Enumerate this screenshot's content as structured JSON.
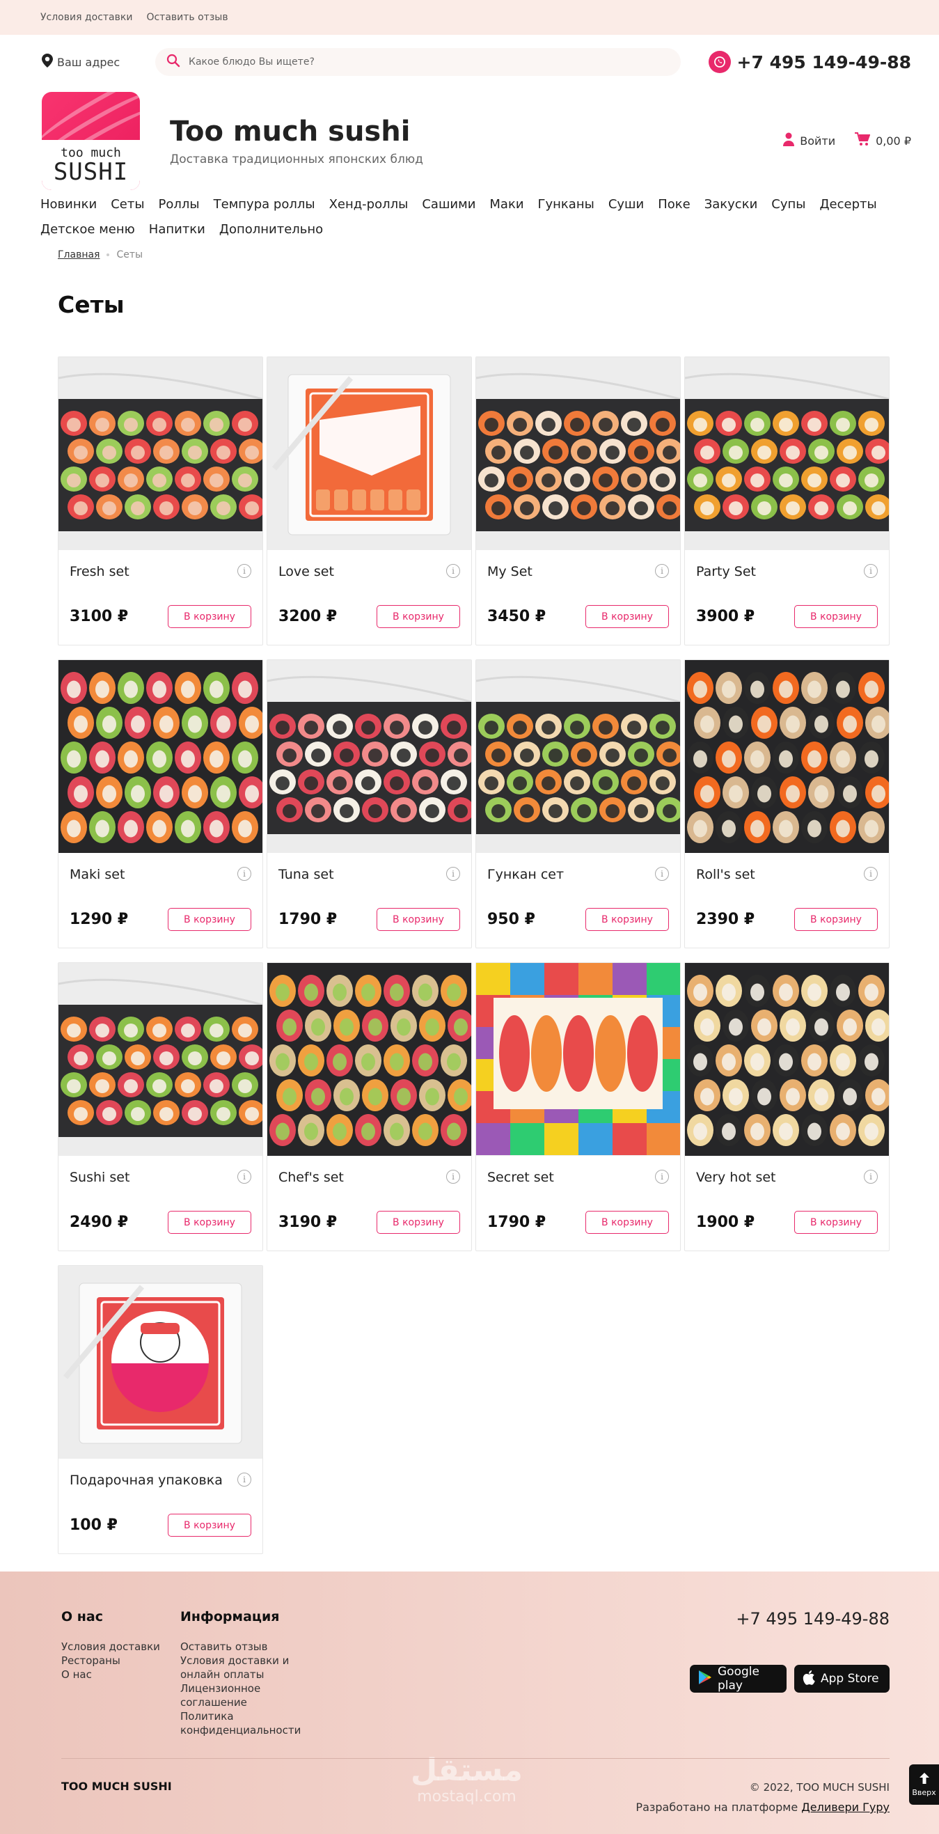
{
  "topbar": {
    "links": [
      "Условия доставки",
      "Оставить отзыв"
    ]
  },
  "header": {
    "address": "Ваш адрес",
    "search_placeholder": "Какое блюдо Вы ищете?",
    "phone": "+7 495 149-49-88",
    "logo_line1": "too much",
    "logo_line2": "SUSHI",
    "brand_title": "Too much sushi",
    "brand_subtitle": "Доставка традиционных японских блюд",
    "login": "Войти",
    "cart": "0,00 ₽"
  },
  "nav": [
    "Новинки",
    "Сеты",
    "Роллы",
    "Темпура роллы",
    "Хенд-роллы",
    "Сашими",
    "Маки",
    "Гунканы",
    "Суши",
    "Поке",
    "Закуски",
    "Супы",
    "Десерты",
    "Детское меню",
    "Напитки",
    "Дополнительно"
  ],
  "breadcrumb": {
    "home": "Главная",
    "current": "Сеты"
  },
  "page_title": "Сеты",
  "cart_button": "В корзину",
  "products": [
    {
      "name": "Fresh set",
      "price": "3100 ₽",
      "bg": "light",
      "palette": [
        "#e84b4b",
        "#f28a4a",
        "#9ccc5a",
        "#f3c9b2"
      ]
    },
    {
      "name": "Love set",
      "price": "3200 ₽",
      "bg": "box",
      "palette": [
        "#f26a3a",
        "#f5a06a",
        "#ffffff",
        "#e84b4b"
      ]
    },
    {
      "name": "My Set",
      "price": "3450 ₽",
      "bg": "light",
      "palette": [
        "#f07a3a",
        "#f5b07a",
        "#f6e3cf",
        "#2c2c2c"
      ]
    },
    {
      "name": "Party Set",
      "price": "3900 ₽",
      "bg": "light",
      "palette": [
        "#f0a030",
        "#e84b4b",
        "#8cc04a",
        "#f7f0e0"
      ]
    },
    {
      "name": "Maki set",
      "price": "1290 ₽",
      "bg": "dark",
      "palette": [
        "#e04858",
        "#f28a3a",
        "#8cc04a",
        "#f5f0e6"
      ]
    },
    {
      "name": "Tuna set",
      "price": "1790 ₽",
      "bg": "light",
      "palette": [
        "#e04858",
        "#f28a8a",
        "#f5f0e6",
        "#2c2c2c"
      ]
    },
    {
      "name": "Гункан сет",
      "price": "950 ₽",
      "bg": "light",
      "palette": [
        "#9ccc5a",
        "#f28a3a",
        "#f3d9b0",
        "#2c2c2c"
      ]
    },
    {
      "name": "Roll's set",
      "price": "2390 ₽",
      "bg": "dark",
      "palette": [
        "#f26a20",
        "#d9b890",
        "#2a2a2a",
        "#f0e6d2"
      ]
    },
    {
      "name": "Sushi set",
      "price": "2490 ₽",
      "bg": "light",
      "palette": [
        "#f28a3a",
        "#e04858",
        "#8cc04a",
        "#f5f0e6"
      ]
    },
    {
      "name": "Chef's set",
      "price": "3190 ₽",
      "bg": "dark",
      "palette": [
        "#f0a040",
        "#e04858",
        "#d9c090",
        "#9ccc5a"
      ]
    },
    {
      "name": "Secret set",
      "price": "1790 ₽",
      "bg": "popart",
      "palette": [
        "#f28a3a",
        "#e84b4b",
        "#f5d020",
        "#3aa0e0"
      ]
    },
    {
      "name": "Very hot set",
      "price": "1900 ₽",
      "bg": "dark",
      "palette": [
        "#e8b070",
        "#f0d8a0",
        "#2a2a2a",
        "#f5f0e6"
      ]
    },
    {
      "name": "Подарочная упаковка",
      "price": "100 ₽",
      "bg": "gift",
      "palette": [
        "#e84b4b",
        "#ffffff",
        "#f26a3a",
        "#e8296b"
      ]
    }
  ],
  "footer": {
    "col1_title": "О нас",
    "col1_links": [
      "Условия доставки",
      "Рестораны",
      "О нас"
    ],
    "col2_title": "Информация",
    "col2_links": [
      "Оставить отзыв",
      "Условия доставки и онлайн оплаты",
      "Лицензионное соглашение",
      "Политика конфиденциальности"
    ],
    "phone": "+7 495 149-49-88",
    "google_play": "Google play",
    "app_store": "App Store",
    "brand": "TOO MUCH SUSHI",
    "copyright": "© 2022, TOO MUCH SUSHI",
    "developed_prefix": "Разработано на платформе",
    "developed_link": "Деливери Гуру",
    "watermark_ar": "مستقل",
    "watermark_en": "mostaql.com",
    "to_top": "Вверх"
  },
  "colors": {
    "accent": "#e8296b",
    "topbar_bg": "#fbece7",
    "footer_bg": "#f2d2ca"
  }
}
